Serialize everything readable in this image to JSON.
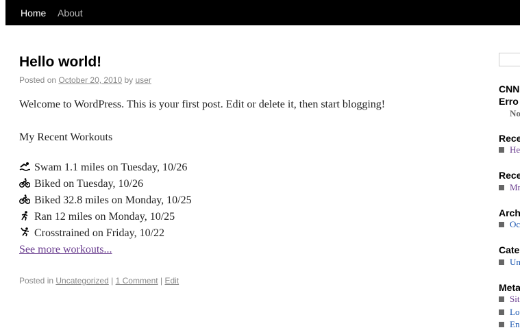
{
  "nav": {
    "items": [
      "Home",
      "About"
    ]
  },
  "post": {
    "title": "Hello world!",
    "posted_on_label": "Posted on",
    "date": "October 20, 2010",
    "by_label": "by",
    "author": "user",
    "welcome_text": "Welcome to WordPress. This is your first post. Edit or delete it, then start blogging!",
    "workouts_heading": "My Recent Workouts",
    "workouts": [
      {
        "icon": "swim-icon",
        "text": "Swam 1.1 miles on Tuesday, 10/26"
      },
      {
        "icon": "bike-icon",
        "text": "Biked on Tuesday, 10/26"
      },
      {
        "icon": "bike-icon",
        "text": "Biked 32.8 miles on Monday, 10/25"
      },
      {
        "icon": "run-icon",
        "text": "Ran 12 miles on Monday, 10/25"
      },
      {
        "icon": "crosstrain-icon",
        "text": "Crosstrained on Friday, 10/22"
      }
    ],
    "see_more": "See more workouts...",
    "footer": {
      "posted_in_label": "Posted in",
      "category": "Uncategorized",
      "separator": "|",
      "comments": "1 Comment",
      "edit": "Edit"
    }
  },
  "sidebar": {
    "cnn_title_line1": "CNN",
    "cnn_title_line2": "Erro",
    "cnn_sub": "No",
    "recent_posts_title": "Rece",
    "recent_posts_item": "He",
    "recent_comments_title": "Rece",
    "recent_comments_item": "Mr",
    "archives_title": "Arch",
    "archives_item": "Oc",
    "categories_title": "Cate",
    "categories_item": "Un",
    "meta_title": "Meta",
    "meta_items": [
      "Sit",
      "Lo",
      "En"
    ]
  },
  "colors": {
    "nav_bg": "#000000",
    "visited_link": "#6a3d8f",
    "link": "#1b57b1",
    "meta_text": "#888888"
  }
}
